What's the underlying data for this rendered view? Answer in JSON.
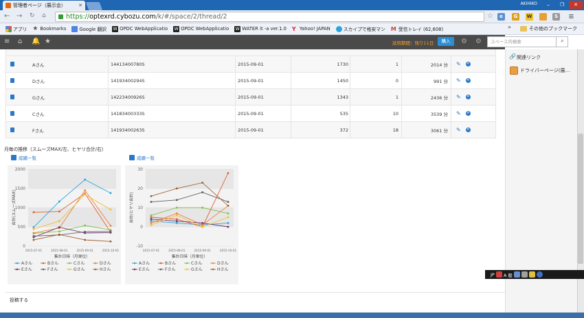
{
  "browser": {
    "tab_title": "管理者ページ（展示会）",
    "user": "AKIHIKO",
    "url_scheme": "https://",
    "url_host": "optexrd.cybozu.com",
    "url_path": "/k/#/space/2/thread/2",
    "bookmarks": [
      {
        "label": "アプリ",
        "icon": "apps-grid-icon",
        "color": "#e05050"
      },
      {
        "label": "Bookmarks",
        "icon": "star-icon",
        "color": "#555555"
      },
      {
        "label": "Google 翻訳",
        "icon": "google-translate-icon",
        "color": "#4a86e8"
      },
      {
        "label": "OPDC WebApplicatio",
        "icon": "w-icon",
        "color": "#222222"
      },
      {
        "label": "OPDC WebApplicatio",
        "icon": "w-icon",
        "color": "#222222"
      },
      {
        "label": "WATER it -a ver.1.0",
        "icon": "w-icon",
        "color": "#222222"
      },
      {
        "label": "Yahoo! JAPAN",
        "icon": "yahoo-icon",
        "color": "#e02020"
      },
      {
        "label": "スカイプで格安マン",
        "icon": "skype-icon",
        "color": "#2aa4e0"
      },
      {
        "label": "受信トレイ (62,608)",
        "icon": "gmail-icon",
        "color": "#d04030"
      }
    ],
    "bookmarks_more": "»",
    "other_bookmarks": "その他のブックマーク"
  },
  "appbar": {
    "trial_text": "試用期間：残り11日",
    "buy_label": "購入",
    "search_placeholder": "スペース内検索"
  },
  "side": {
    "related_links_label": "関連リンク",
    "driver_page_label": "ドライバーページ(展…"
  },
  "table": {
    "rows": [
      {
        "name": "Aさん",
        "id": "14413400780S",
        "date": "2015-09-01",
        "v1": "1730",
        "v2": "1",
        "time": "2014 分"
      },
      {
        "name": "Dさん",
        "id": "14193400294S",
        "date": "2015-09-01",
        "v1": "1450",
        "v2": "0",
        "time": "991 分"
      },
      {
        "name": "Gさん",
        "id": "14223400926S",
        "date": "2015-09-01",
        "v1": "1343",
        "v2": "1",
        "time": "2436 分"
      },
      {
        "name": "Cさん",
        "id": "14183400333S",
        "date": "2015-09-01",
        "v1": "535",
        "v2": "10",
        "time": "3539 分"
      },
      {
        "name": "Fさん",
        "id": "14193400263S",
        "date": "2015-09-01",
        "v1": "372",
        "v2": "18",
        "time": "3061 分"
      }
    ]
  },
  "charts_heading": "月毎の推移（スムーズMAX/左、ヒヤリ合計/右）",
  "chart_links": [
    "成績一覧",
    "成績一覧"
  ],
  "post_label": "投稿する",
  "taskbar": {
    "lang": "JP",
    "ime_mode": "A 般"
  },
  "chart_data": [
    {
      "type": "line",
      "categories": [
        "2015-07-01",
        "2015-08-01",
        "2015-09-01",
        "2015-10-01"
      ],
      "xlabel": "集計日時（月単位）",
      "ylabel": "合計(スムーズMAX)",
      "ylim": [
        0,
        2000
      ],
      "yticks": [
        0,
        500,
        1000,
        1500,
        2000
      ],
      "series": [
        {
          "name": "Aさん",
          "color": "#2aa4e0",
          "values": [
            490,
            1160,
            1730,
            1380
          ]
        },
        {
          "name": "Bさん",
          "color": "#e06030",
          "values": [
            880,
            900,
            1370,
            360
          ]
        },
        {
          "name": "Cさん",
          "color": "#80c050",
          "values": [
            330,
            380,
            535,
            420
          ]
        },
        {
          "name": "Dさん",
          "color": "#f08040",
          "values": [
            340,
            470,
            1450,
            530
          ]
        },
        {
          "name": "Eさん",
          "color": "#703070",
          "values": [
            230,
            490,
            340,
            350
          ]
        },
        {
          "name": "Fさん",
          "color": "#606060",
          "values": [
            260,
            290,
            372,
            380
          ]
        },
        {
          "name": "Gさん",
          "color": "#f0c030",
          "values": [
            440,
            650,
            1343,
            950
          ]
        },
        {
          "name": "Hさん",
          "color": "#a06030",
          "values": [
            160,
            300,
            160,
            120
          ]
        }
      ],
      "legend": "bottom"
    },
    {
      "type": "line",
      "categories": [
        "2015-07-01",
        "2015-08-01",
        "2015-09-01",
        "2015-10-01"
      ],
      "xlabel": "集計日時（月単位）",
      "ylabel": "合計(ヒヤリ合計)",
      "ylim": [
        -10,
        30
      ],
      "yticks": [
        -10,
        0,
        10,
        20,
        30
      ],
      "series": [
        {
          "name": "Aさん",
          "color": "#2aa4e0",
          "values": [
            3,
            2,
            1,
            2
          ]
        },
        {
          "name": "Bさん",
          "color": "#e06030",
          "values": [
            5,
            4,
            0,
            28
          ]
        },
        {
          "name": "Cさん",
          "color": "#80c050",
          "values": [
            6,
            10,
            10,
            7
          ]
        },
        {
          "name": "Dさん",
          "color": "#f08040",
          "values": [
            2,
            7,
            1,
            11
          ]
        },
        {
          "name": "Eさん",
          "color": "#703070",
          "values": [
            4,
            3,
            2,
            0
          ]
        },
        {
          "name": "Fさん",
          "color": "#606060",
          "values": [
            13,
            14,
            18,
            13
          ]
        },
        {
          "name": "Gさん",
          "color": "#f0c030",
          "values": [
            1,
            6,
            0,
            5
          ]
        },
        {
          "name": "Hさん",
          "color": "#a06030",
          "values": [
            16,
            20,
            23,
            11
          ]
        }
      ],
      "legend": "bottom"
    }
  ]
}
